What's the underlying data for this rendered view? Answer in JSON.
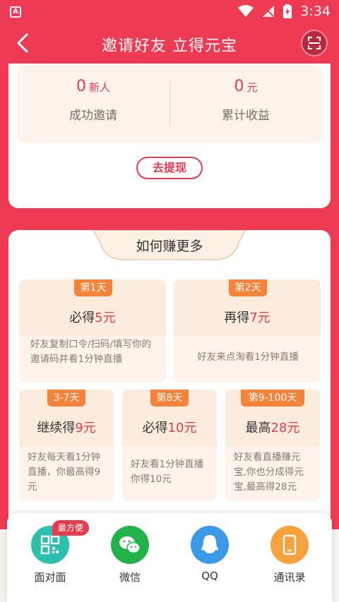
{
  "status_bar": {
    "time": "3:34"
  },
  "header": {
    "title": "邀请好友 立得元宝"
  },
  "stats": [
    {
      "value": "0",
      "unit": "新人",
      "label": "成功邀请"
    },
    {
      "value": "0",
      "unit": "元",
      "label": "累计收益"
    }
  ],
  "withdraw_label": "去提现",
  "earn_section": {
    "title": "如何赚更多"
  },
  "tasks": [
    {
      "badge": "第1天",
      "prefix": "必得",
      "amount": "5元",
      "desc": "好友复制口令/扫码/填写你的邀请码并看1分钟直播"
    },
    {
      "badge": "第2天",
      "prefix": "再得",
      "amount": "7元",
      "desc": "好友来点淘看1分钟直播"
    },
    {
      "badge": "3-7天",
      "prefix": "继续得",
      "amount": "9元",
      "desc": "好友每天看1分钟直播，你最高得9元"
    },
    {
      "badge": "第8天",
      "prefix": "必得",
      "amount": "10元",
      "desc": "好友看1分钟直播你得10元"
    },
    {
      "badge": "第9-100天",
      "prefix": "最高",
      "amount": "28元",
      "desc": "好友看直播赚元宝,你也分成得元宝,最高得28元"
    }
  ],
  "share": {
    "tag": "最方便",
    "items": [
      {
        "label": "面对面",
        "icon": "qr-code-icon",
        "color": "#2bbfae"
      },
      {
        "label": "微信",
        "icon": "wechat-icon",
        "color": "#21b34a"
      },
      {
        "label": "QQ",
        "icon": "qq-icon",
        "color": "#3a9ae8"
      },
      {
        "label": "通讯录",
        "icon": "contacts-icon",
        "color": "#f7a23c"
      }
    ]
  },
  "colors": {
    "primary": "#ef3a54",
    "accent": "#e83a4f",
    "badge": "#f5833a"
  }
}
